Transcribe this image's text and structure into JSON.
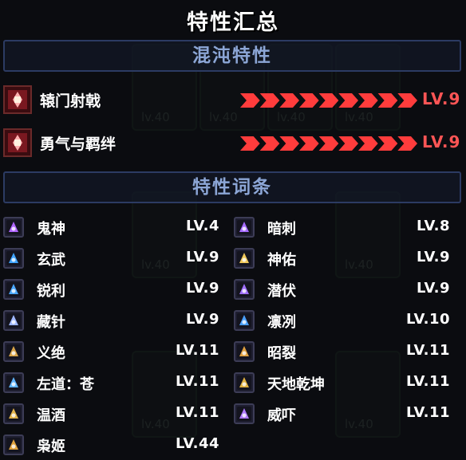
{
  "title": "特性汇总",
  "sections": {
    "chaos": "混沌特性",
    "entries": "特性词条"
  },
  "chaos_traits": [
    {
      "icon": "crossbow-emblem-icon",
      "label": "辕门射戟",
      "level": "LV.9",
      "progress": 1.0
    },
    {
      "icon": "brave-bond-icon",
      "label": "勇气与羁绊",
      "level": "LV.9",
      "progress": 1.0
    }
  ],
  "traits_left": [
    {
      "icon": "ghost-god-icon",
      "label": "鬼神",
      "level": "LV.4",
      "color": "#b065ff"
    },
    {
      "icon": "black-tortoise-icon",
      "label": "玄武",
      "level": "LV.9",
      "color": "#3fa4ff"
    },
    {
      "icon": "sharp-arrow-icon",
      "label": "锐利",
      "level": "LV.9",
      "color": "#4aa8ff"
    },
    {
      "icon": "hidden-needle-icon",
      "label": "藏针",
      "level": "LV.9",
      "color": "#9fb7ff"
    },
    {
      "icon": "righteous-icon",
      "label": "义绝",
      "level": "LV.11",
      "color": "#d8a44a"
    },
    {
      "icon": "left-path-icon",
      "label": "左道：苍",
      "level": "LV.11",
      "color": "#5fb4ff"
    },
    {
      "icon": "warm-wine-icon",
      "label": "温酒",
      "level": "LV.11",
      "color": "#e2b34a"
    },
    {
      "icon": "owl-lady-icon",
      "label": "枭姬",
      "level": "LV.44",
      "color": "#e0a23c"
    }
  ],
  "traits_right": [
    {
      "icon": "dark-stab-icon",
      "label": "暗刺",
      "level": "LV.8",
      "color": "#a66bff"
    },
    {
      "icon": "divine-blessing-icon",
      "label": "神佑",
      "level": "LV.9",
      "color": "#f0c85a"
    },
    {
      "icon": "lurk-icon",
      "label": "潜伏",
      "level": "LV.9",
      "color": "#a070ff"
    },
    {
      "icon": "frost-icon",
      "label": "凛冽",
      "level": "LV.10",
      "color": "#4aa0ff"
    },
    {
      "icon": "split-icon",
      "label": "昭裂",
      "level": "LV.11",
      "color": "#e0a040"
    },
    {
      "icon": "heaven-earth-icon",
      "label": "天地乾坤",
      "level": "LV.11",
      "color": "#e0b040"
    },
    {
      "icon": "intimidate-icon",
      "label": "威吓",
      "level": "LV.11",
      "color": "#b07aff"
    }
  ],
  "background_cards": [
    "lv.40",
    "lv.40",
    "lv.40",
    "lv.40",
    "lv.40",
    "lv.40",
    "lv.40",
    "lv.40"
  ],
  "colors": {
    "chaos_accent": "#ff3c3c",
    "section_text": "#8ca6d6",
    "text": "#ffffff"
  }
}
